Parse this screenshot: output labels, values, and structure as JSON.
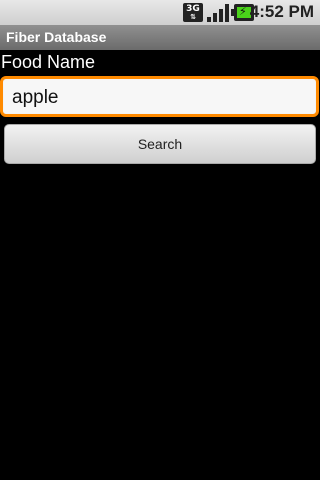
{
  "status_bar": {
    "network_label": "3G",
    "time": "4:52 PM",
    "icons": [
      "3g-data-icon",
      "signal-strength-icon",
      "battery-charging-icon"
    ]
  },
  "app": {
    "title": "Fiber Database"
  },
  "form": {
    "field_label": "Food Name",
    "field_value": "apple",
    "search_button_label": "Search"
  },
  "colors": {
    "focus_border": "#ff8a00",
    "background": "#000000"
  }
}
